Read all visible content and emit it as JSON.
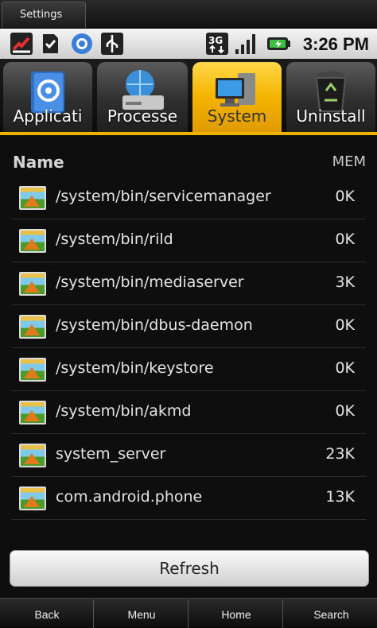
{
  "window": {
    "title_tab": "Settings"
  },
  "status_bar": {
    "time": "3:26 PM",
    "icons": [
      "missed-call-icon",
      "sd-card-icon",
      "sync-icon",
      "usb-icon",
      "3g-icon",
      "signal-icon",
      "battery-icon"
    ]
  },
  "tabs": [
    {
      "label": "Applicati",
      "icon": "address-book-icon",
      "active": false
    },
    {
      "label": "Processe",
      "icon": "hard-drive-icon",
      "active": false
    },
    {
      "label": "System",
      "icon": "computer-icon",
      "active": true
    },
    {
      "label": "Uninstall",
      "icon": "recycle-bin-icon",
      "active": false
    }
  ],
  "list_header": {
    "name": "Name",
    "mem": "MEM"
  },
  "processes": [
    {
      "name": "/system/bin/servicemanager",
      "mem": "0K"
    },
    {
      "name": "/system/bin/rild",
      "mem": "0K"
    },
    {
      "name": "/system/bin/mediaserver",
      "mem": "3K"
    },
    {
      "name": "/system/bin/dbus-daemon",
      "mem": "0K"
    },
    {
      "name": "/system/bin/keystore",
      "mem": "0K"
    },
    {
      "name": "/system/bin/akmd",
      "mem": "0K"
    },
    {
      "name": "system_server",
      "mem": "23K"
    },
    {
      "name": "com.android.phone",
      "mem": "13K"
    }
  ],
  "refresh_label": "Refresh",
  "bottom_nav": {
    "back": "Back",
    "menu": "Menu",
    "home": "Home",
    "search": "Search"
  },
  "colors": {
    "accent": "#f2b200",
    "background": "#0e0e0e"
  }
}
